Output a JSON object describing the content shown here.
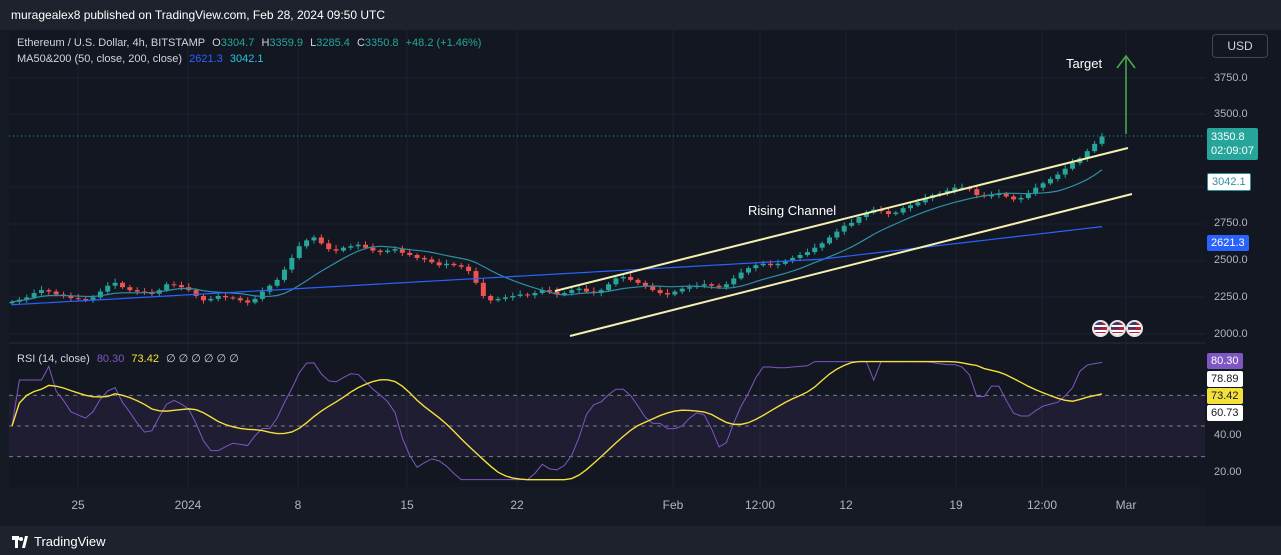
{
  "publisher": "muragealex8 published on TradingView.com, Feb 28, 2024 09:50 UTC",
  "legend": {
    "symbol": "Ethereum / U.S. Dollar, 4h, BITSTAMP",
    "o_label": "O",
    "o_value": "3304.7",
    "h_label": "H",
    "h_value": "3359.9",
    "l_label": "L",
    "l_value": "3285.4",
    "c_label": "C",
    "c_value": "3350.8",
    "change": "+48.2 (+1.46%)",
    "ma_label": "MA50&200 (50, close, 200, close)",
    "ma200_value": "2621.3",
    "ma50_value": "3042.1"
  },
  "rsi_legend": {
    "label": "RSI (14, close)",
    "rsi_value": "80.30",
    "ma_value": "73.42",
    "extras": "∅ ∅ ∅ ∅ ∅ ∅"
  },
  "currency_button": "USD",
  "price_axis": [
    "3750.0",
    "3500.0",
    "2750.0",
    "2500.0",
    "2250.0",
    "2000.0"
  ],
  "price_tags": {
    "last_price": "3350.8",
    "countdown": "02:09:07",
    "ma50": "3042.1",
    "ma200": "2621.3"
  },
  "rsi_axis": [
    "40.00",
    "20.00"
  ],
  "rsi_tags": {
    "rsi": "80.30",
    "upper_band": "78.89",
    "rsi_ma": "73.42",
    "lower_band": "60.73"
  },
  "time_axis": [
    "25",
    "2024",
    "8",
    "15",
    "22",
    "Feb",
    "12:00",
    "12",
    "19",
    "12:00",
    "Mar"
  ],
  "annotations": {
    "target": "Target",
    "channel": "Rising Channel"
  },
  "brand": "TradingView",
  "colors": {
    "up": "#26a69a",
    "down": "#ef5350",
    "ma50": "#2f8fa3",
    "ma200": "#2962ff",
    "rsi": "#7e57c2",
    "rsi_ma": "#f3e03b",
    "channel": "#f5f0b0",
    "target_arrow": "#4caf50"
  },
  "chart_data": {
    "type": "candlestick",
    "timeframe": "4h",
    "price_ylim": [
      1950,
      3900
    ],
    "rsi_ylim": [
      10,
      95
    ],
    "rsi_levels": [
      70,
      50,
      30
    ],
    "closes": [
      2220,
      2235,
      2250,
      2280,
      2300,
      2290,
      2270,
      2260,
      2245,
      2240,
      2235,
      2250,
      2290,
      2330,
      2350,
      2320,
      2300,
      2290,
      2280,
      2275,
      2300,
      2340,
      2335,
      2320,
      2300,
      2260,
      2230,
      2240,
      2260,
      2250,
      2245,
      2230,
      2215,
      2240,
      2290,
      2330,
      2370,
      2440,
      2520,
      2600,
      2640,
      2660,
      2620,
      2580,
      2570,
      2590,
      2600,
      2610,
      2590,
      2570,
      2560,
      2570,
      2580,
      2555,
      2540,
      2520,
      2510,
      2490,
      2470,
      2480,
      2470,
      2460,
      2430,
      2350,
      2260,
      2230,
      2240,
      2250,
      2260,
      2270,
      2265,
      2280,
      2300,
      2290,
      2270,
      2280,
      2300,
      2310,
      2290,
      2280,
      2300,
      2340,
      2380,
      2390,
      2370,
      2350,
      2330,
      2300,
      2280,
      2270,
      2290,
      2310,
      2320,
      2330,
      2340,
      2330,
      2320,
      2340,
      2380,
      2420,
      2450,
      2470,
      2480,
      2470,
      2480,
      2500,
      2520,
      2540,
      2560,
      2590,
      2620,
      2660,
      2700,
      2740,
      2760,
      2800,
      2830,
      2850,
      2840,
      2820,
      2830,
      2860,
      2880,
      2900,
      2930,
      2950,
      2960,
      2980,
      3000,
      3000,
      2990,
      2950,
      2940,
      2950,
      2960,
      2940,
      2920,
      2930,
      2960,
      3000,
      3030,
      3060,
      3090,
      3130,
      3170,
      3200,
      3250,
      3300,
      3350
    ]
  }
}
